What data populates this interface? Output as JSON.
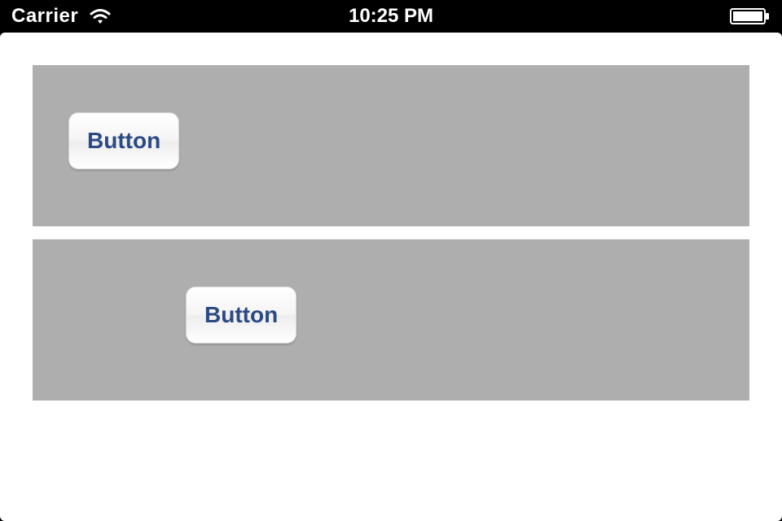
{
  "status_bar": {
    "carrier": "Carrier",
    "time": "10:25 PM"
  },
  "cells": [
    {
      "button_label": "Button"
    },
    {
      "button_label": "Button"
    }
  ]
}
